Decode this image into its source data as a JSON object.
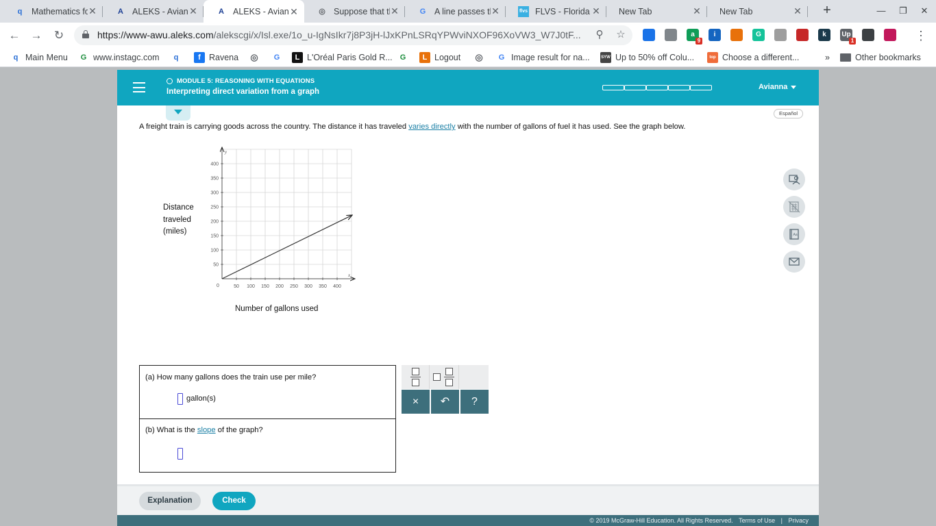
{
  "browser": {
    "tabs": [
      {
        "title": "Mathematics fo",
        "icon": "q",
        "icon_color": "#2a6fd6"
      },
      {
        "title": "ALEKS - Aviann",
        "icon": "A",
        "icon_color": "#1c3f94"
      },
      {
        "title": "ALEKS - Aviann",
        "icon": "A",
        "icon_color": "#1c3f94",
        "active": true
      },
      {
        "title": "Suppose that th",
        "icon": "globe",
        "icon_color": "#5f6368"
      },
      {
        "title": "A line passes th",
        "icon": "G",
        "icon_color": "#4285f4"
      },
      {
        "title": "FLVS - Florida V",
        "icon": "flvs",
        "icon_color": "#3ab0e2"
      },
      {
        "title": "New Tab",
        "icon": "",
        "icon_color": ""
      },
      {
        "title": "New Tab",
        "icon": "",
        "icon_color": ""
      }
    ],
    "new_tab": "+",
    "url_host": "https://www-awu.aleks.com",
    "url_path": "/alekscgi/x/Isl.exe/1o_u-IgNsIkr7j8P3jH-lJxKPnLSRqYPWviNXOF96XoVW3_W7J0tF...",
    "extensions": [
      {
        "label": "",
        "color": "#1a73e8"
      },
      {
        "label": "",
        "color": "#80868b"
      },
      {
        "label": "a",
        "color": "#0f9d58",
        "badge": "9"
      },
      {
        "label": "i",
        "color": "#1565c0"
      },
      {
        "label": "",
        "color": "#e8710a"
      },
      {
        "label": "G",
        "color": "#15c39a"
      },
      {
        "label": "",
        "color": "#9e9e9e"
      },
      {
        "label": "",
        "color": "#c62828"
      },
      {
        "label": "k",
        "color": "#1b3a4b"
      },
      {
        "label": "Up",
        "color": "#5f6368",
        "badge": "1"
      },
      {
        "label": "",
        "color": "#3c4043"
      },
      {
        "label": "",
        "color": "#c2185b"
      }
    ],
    "bookmarks": [
      {
        "label": "Main Menu",
        "icon": "q",
        "color": "#2a6fd6"
      },
      {
        "label": "www.instagc.com",
        "icon": "G",
        "color": "#1e8e3e"
      },
      {
        "label": "",
        "icon": "q",
        "color": "#2a6fd6"
      },
      {
        "label": "Ravena",
        "icon": "f",
        "color": "#1877f2"
      },
      {
        "label": "",
        "icon": "globe",
        "color": "#5f6368"
      },
      {
        "label": "",
        "icon": "G",
        "color": "#4285f4"
      },
      {
        "label": "L'Oréal Paris Gold R...",
        "icon": "L",
        "color": "#111111"
      },
      {
        "label": "",
        "icon": "G",
        "color": "#1e8e3e"
      },
      {
        "label": "Logout",
        "icon": "L",
        "color": "#e8710a"
      },
      {
        "label": "",
        "icon": "globe",
        "color": "#5f6368"
      },
      {
        "label": "Image result for na...",
        "icon": "G",
        "color": "#4285f4"
      },
      {
        "label": "Up to 50% off Colu...",
        "icon": "SYW",
        "color": "#444444"
      },
      {
        "label": "Choose a different...",
        "icon": "top",
        "color": "#ef6c3a"
      }
    ],
    "more_bookmarks": "»",
    "other_bookmarks": "Other bookmarks"
  },
  "aleks": {
    "module": "MODULE 5: REASONING WITH EQUATIONS",
    "topic": "Interpreting direct variation from a graph",
    "user": "Avianna",
    "espanol": "Español",
    "problem_before": "A freight train is carrying goods across the country. The distance it has traveled ",
    "problem_link": "varies directly",
    "problem_after": " with the number of gallons of fuel it has used. See the graph below.",
    "graph": {
      "ylabel": "Distance traveled (miles)",
      "xlabel": "Number of gallons used",
      "x_axis_letter": "x",
      "y_axis_letter": "y",
      "origin_label": "0"
    },
    "question_a": "(a) How many gallons does the train use per mile?",
    "unit_a": "gallon(s)",
    "question_b_before": "(b) What is the ",
    "question_b_link": "slope",
    "question_b_after": " of the graph?",
    "keypad": {
      "clear": "×",
      "undo": "↶",
      "help": "?"
    },
    "explanation_button": "Explanation",
    "check_button": "Check",
    "copyright": "© 2019 McGraw-Hill Education. All Rights Reserved.",
    "terms": "Terms of Use",
    "privacy": "Privacy",
    "footer_sep": "|"
  },
  "chart_data": {
    "type": "line",
    "title": "",
    "xlabel": "Number of gallons used",
    "ylabel": "Distance traveled (miles)",
    "xlim": [
      0,
      450
    ],
    "ylim": [
      0,
      450
    ],
    "x_ticks": [
      50,
      100,
      150,
      200,
      250,
      300,
      350,
      400
    ],
    "y_ticks": [
      50,
      100,
      150,
      200,
      250,
      300,
      350,
      400
    ],
    "grid": true,
    "series": [
      {
        "x": [
          0,
          450
        ],
        "y": [
          0,
          220
        ]
      }
    ]
  }
}
